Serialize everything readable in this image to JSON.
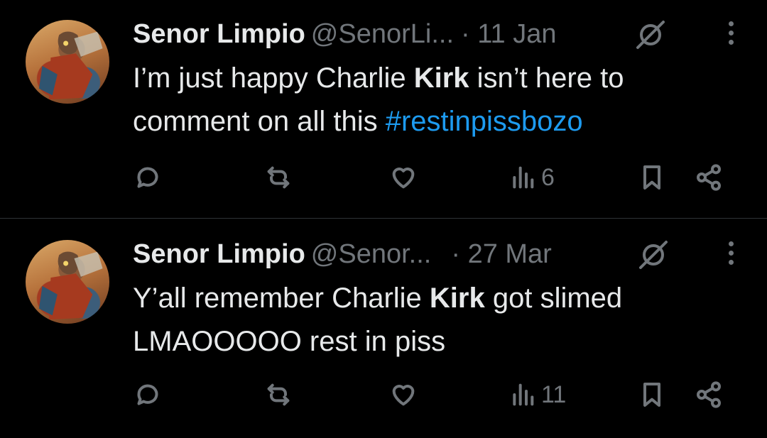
{
  "tweets": [
    {
      "author": "Senor Limpio",
      "handle": "@SenorLi...",
      "time": "· 11 Jan",
      "text_parts": [
        "I’m just happy Charlie ",
        "Kirk",
        " isn’t here to comment on all this ",
        "#restinpissbozo"
      ],
      "views": "6",
      "icons": [
        "reply-icon",
        "retweet-icon",
        "like-icon",
        "views-icon",
        "bookmark-icon",
        "share-icon"
      ]
    },
    {
      "author": "Senor Limpio",
      "handle": "@Senor...",
      "time": "· 27 Mar",
      "text_parts": [
        "Y’all remember Charlie ",
        "Kirk",
        " got slimed LMAOOOOO rest in piss"
      ],
      "views": "11",
      "icons": [
        "reply-icon",
        "retweet-icon",
        "like-icon",
        "views-icon",
        "bookmark-icon",
        "share-icon"
      ]
    }
  ],
  "colors": {
    "background": "#000000",
    "text": "#e7e9ea",
    "muted": "#71767b",
    "link": "#1d9bf0",
    "divider": "#2f3336"
  }
}
